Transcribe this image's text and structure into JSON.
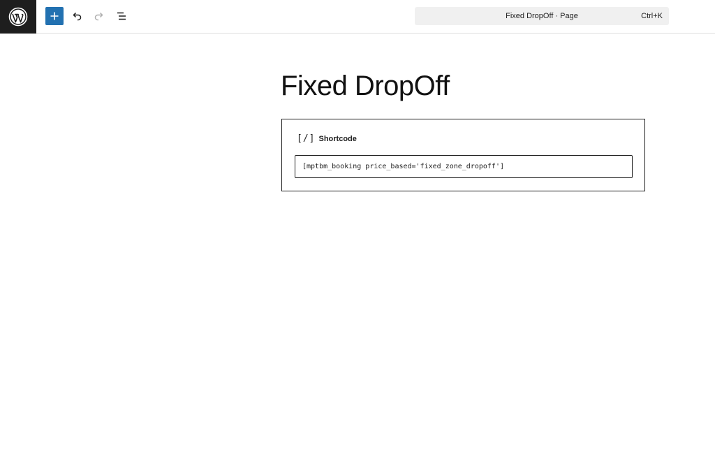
{
  "toolbar": {
    "logo_icon": "wordpress-logo-icon",
    "add_icon": "plus-icon",
    "undo_icon": "undo-icon",
    "redo_icon": "redo-icon",
    "list_view_icon": "list-view-icon",
    "accent_color": "#2271b1"
  },
  "command_bar": {
    "title": "Fixed DropOff · Page",
    "shortcut": "Ctrl+K"
  },
  "page": {
    "title": "Fixed DropOff"
  },
  "shortcode_block": {
    "icon": "[/]",
    "label": "Shortcode",
    "value": "[mptbm_booking price_based='fixed_zone_dropoff']"
  }
}
